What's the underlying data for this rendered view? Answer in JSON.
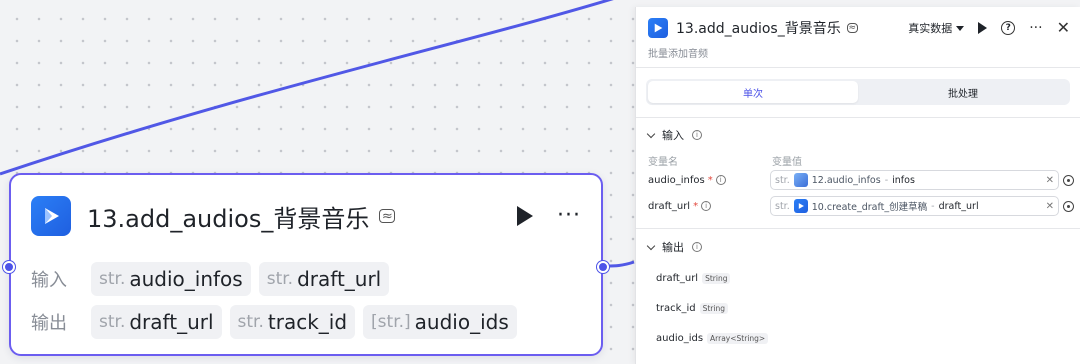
{
  "node": {
    "title": "13.add_audios_背景音乐",
    "input_label": "输入",
    "output_label": "输出",
    "inputs": [
      {
        "type": "str.",
        "name": "audio_infos"
      },
      {
        "type": "str.",
        "name": "draft_url"
      }
    ],
    "outputs": [
      {
        "type": "str.",
        "name": "draft_url"
      },
      {
        "type": "str.",
        "name": "track_id"
      },
      {
        "type": "[str.]",
        "name": "audio_ids"
      }
    ]
  },
  "panel": {
    "title": "13.add_audios_背景音乐",
    "subtitle": "批量添加音频",
    "mode_label": "真实数据",
    "tabs": [
      "单次",
      "批处理"
    ],
    "active_tab": 0,
    "input_section": "输入",
    "col_name": "变量名",
    "col_value": "变量值",
    "inputs": [
      {
        "name": "audio_infos",
        "type": "str.",
        "ref": "12.audio_infos",
        "field": "infos",
        "icon": "image-icon"
      },
      {
        "name": "draft_url",
        "type": "str.",
        "ref": "10.create_draft_创建草稿",
        "field": "draft_url",
        "icon": "app-icon"
      }
    ],
    "output_section": "输出",
    "outputs": [
      {
        "name": "draft_url",
        "type": "String"
      },
      {
        "name": "track_id",
        "type": "String"
      },
      {
        "name": "audio_ids",
        "type": "Array<String>"
      }
    ]
  },
  "colors": {
    "accent": "#4d53e8",
    "node_border": "#6b5df0",
    "required": "#e2483d"
  },
  "icons": [
    "play-icon",
    "more-icon",
    "help-icon",
    "close-icon",
    "chevron-down-icon",
    "info-icon",
    "target-icon",
    "clear-icon"
  ]
}
